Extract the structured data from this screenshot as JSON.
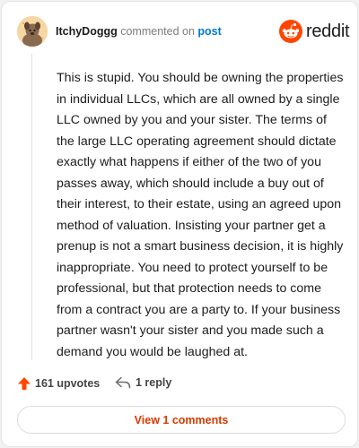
{
  "comment": {
    "username": "ItchyDoggg",
    "action_text": "commented on",
    "post_link": "post",
    "body": "This is stupid. You should be owning the properties in individual LLCs, which are all owned by a single LLC owned by you and your sister. The terms of the large LLC operating agreement should dictate exactly what happens if either of the two of you passes away, which should include a buy out of their interest, to their estate, using an agreed upon method of valuation. Insisting your partner get a prenup is not a smart business decision, it is highly inappropriate. You need to protect yourself to be professional, but that protection needs to come from a contract you are a party to. If your business partner wasn't your sister and you made such a demand you would be laughed at."
  },
  "brand": {
    "wordmark": "reddit",
    "icon": "reddit-snoo-icon",
    "color": "#ff4500"
  },
  "actions": {
    "upvotes_label": "161 upvotes",
    "upvote_icon": "upvote-arrow-icon",
    "upvote_color": "#ff4500",
    "reply_label": "1 reply",
    "reply_icon": "reply-icon",
    "view_comments_label": "View 1 comments",
    "view_comments_color": "#d93a00"
  }
}
